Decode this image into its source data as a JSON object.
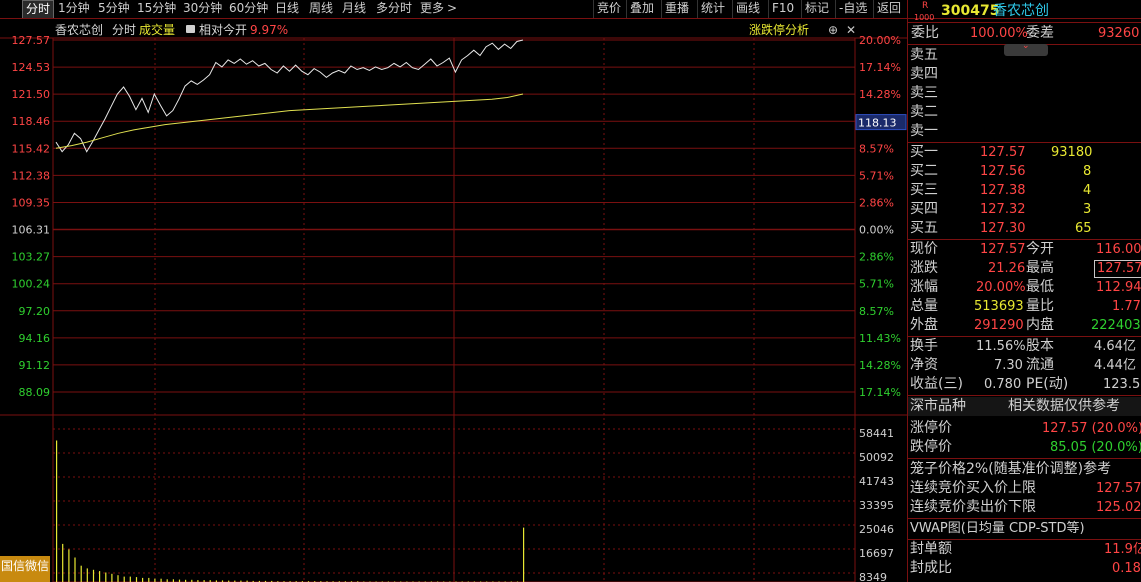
{
  "toolbar": {
    "periods": [
      "分时",
      "1分钟",
      "5分钟",
      "15分钟",
      "30分钟",
      "60分钟",
      "日线",
      "周线",
      "月线",
      "多分时",
      "更多"
    ],
    "more_arrow": ">",
    "actions": [
      "竞价",
      "叠加",
      "重播",
      "统计",
      "画线",
      "F10",
      "标记",
      "-自选",
      "返回"
    ]
  },
  "chart_header": {
    "stock_name": "香农芯创",
    "mode": "分时",
    "volume_label": "成交量",
    "relative_label": "相对今开",
    "relative_value": "9.97%",
    "limit_analysis": "涨跌停分析",
    "plus_icon": "⊕",
    "close_icon": "✕"
  },
  "axis": {
    "price_ticks": [
      "127.57",
      "124.53",
      "121.50",
      "118.46",
      "115.42",
      "112.38",
      "109.35",
      "106.31",
      "103.27",
      "100.24",
      "97.20",
      "94.16",
      "91.12",
      "88.09"
    ],
    "pct_ticks": [
      "20.00%",
      "17.14%",
      "14.28%",
      "11.43%",
      "8.57%",
      "5.71%",
      "2.86%",
      "0.00%",
      "2.86%",
      "5.71%",
      "8.57%",
      "11.43%",
      "14.28%",
      "17.14%"
    ],
    "current_price_tag": "118.13",
    "volume_ticks": [
      "58441",
      "50092",
      "41743",
      "33395",
      "25046",
      "16697",
      "8349"
    ]
  },
  "chart_data": {
    "type": "line",
    "prev_close": 106.31,
    "y_range": [
      85.05,
      127.57
    ],
    "series": [
      {
        "name": "price",
        "color": "#e8e8e8",
        "values": [
          115.9,
          114.8,
          115.6,
          116.9,
          116.3,
          114.8,
          116.0,
          117.3,
          118.6,
          120.0,
          121.4,
          122.2,
          121.1,
          119.6,
          120.9,
          119.3,
          121.4,
          120.1,
          118.9,
          119.5,
          120.8,
          122.3,
          122.9,
          122.5,
          123.0,
          123.6,
          125.0,
          124.5,
          125.3,
          124.9,
          125.4,
          124.8,
          125.2,
          124.6,
          124.9,
          124.2,
          123.8,
          124.6,
          124.0,
          124.7,
          124.0,
          123.6,
          124.3,
          123.9,
          123.3,
          123.8,
          124.1,
          123.8,
          124.6,
          124.2,
          124.4,
          124.1,
          124.5,
          124.2,
          124.4,
          124.9,
          124.5,
          125.0,
          124.4,
          124.2,
          124.8,
          125.4,
          124.6,
          125.0,
          125.5,
          123.9,
          125.3,
          125.8,
          126.4,
          125.8,
          126.8,
          127.2,
          126.5,
          127.1,
          126.6,
          127.4,
          127.57
        ]
      },
      {
        "name": "average",
        "color": "#e0e050",
        "values": [
          115.2,
          115.5,
          115.9,
          116.4,
          116.9,
          117.3,
          117.6,
          117.9,
          118.1,
          118.3,
          118.5,
          118.7,
          118.9,
          119.1,
          119.3,
          119.5,
          119.6,
          119.7,
          119.8,
          119.9,
          120.0,
          120.1,
          120.2,
          120.3,
          120.4,
          120.5,
          120.6,
          120.7,
          120.8,
          121.0,
          121.4
        ]
      }
    ],
    "volume_bars": [
      52000,
      14000,
      12000,
      9000,
      6000,
      5000,
      4500,
      4000,
      3500,
      3000,
      2500,
      2000,
      2000,
      1800,
      1500,
      1500,
      1200,
      1200,
      1000,
      1000,
      900,
      800,
      800,
      700,
      700,
      700,
      600,
      600,
      500,
      500,
      500,
      500,
      400,
      400,
      400,
      400,
      300,
      300,
      300,
      300,
      300,
      300,
      300,
      300,
      250,
      250,
      250,
      250,
      250,
      250,
      200,
      200,
      200,
      200,
      200,
      200,
      200,
      200,
      200,
      200,
      200,
      200,
      200,
      200,
      200,
      200,
      200,
      200,
      200,
      200,
      200,
      200,
      200,
      200,
      200,
      200,
      20000
    ],
    "volume_max": 58441
  },
  "ad": "国信微信",
  "quote": {
    "r_badge": "R",
    "code_sub": "1000",
    "code": "300475",
    "name": "香农芯创",
    "weibi_label": "委比",
    "weibi_value": "100.00%",
    "weicha_label": "委差",
    "weicha_value": "93260",
    "sells": [
      {
        "label": "卖五",
        "price": "",
        "vol": ""
      },
      {
        "label": "卖四",
        "price": "",
        "vol": ""
      },
      {
        "label": "卖三",
        "price": "",
        "vol": ""
      },
      {
        "label": "卖二",
        "price": "",
        "vol": ""
      },
      {
        "label": "卖一",
        "price": "",
        "vol": ""
      }
    ],
    "buys": [
      {
        "label": "买一",
        "price": "127.57",
        "vol": "93180"
      },
      {
        "label": "买二",
        "price": "127.56",
        "vol": "8"
      },
      {
        "label": "买三",
        "price": "127.38",
        "vol": "4"
      },
      {
        "label": "买四",
        "price": "127.32",
        "vol": "3"
      },
      {
        "label": "买五",
        "price": "127.30",
        "vol": "65"
      }
    ],
    "stats": [
      {
        "l1": "现价",
        "v1": "127.57",
        "c1": "r",
        "l2": "今开",
        "v2": "116.00",
        "c2": "r"
      },
      {
        "l1": "涨跌",
        "v1": "21.26",
        "c1": "r",
        "l2": "最高",
        "v2": "127.57",
        "c2": "r"
      },
      {
        "l1": "涨幅",
        "v1": "20.00%",
        "c1": "r",
        "l2": "最低",
        "v2": "112.94",
        "c2": "r"
      },
      {
        "l1": "总量",
        "v1": "513693",
        "c1": "y",
        "l2": "量比",
        "v2": "1.77",
        "c2": "r"
      },
      {
        "l1": "外盘",
        "v1": "291290",
        "c1": "r",
        "l2": "内盘",
        "v2": "222403",
        "c2": "g"
      }
    ],
    "stats2": [
      {
        "l1": "换手",
        "v1": "11.56%",
        "l2": "股本",
        "v2": "4.64亿"
      },
      {
        "l1": "净资",
        "v1": "7.30",
        "l2": "流通",
        "v2": "4.44亿"
      },
      {
        "l1": "收益(三)",
        "v1": "0.780",
        "l2": "PE(动)",
        "v2": "123.5"
      }
    ],
    "market_label": "深市品种",
    "market_note": "相关数据仅供参考",
    "limit_up_label": "涨停价",
    "limit_up_value": "127.57 (20.0%)",
    "limit_down_label": "跌停价",
    "limit_down_value": "85.05 (20.0%)",
    "cage_label": "笼子价格2%(随基准价调整)参考",
    "cont_buy_label": "连续竞价买入价上限",
    "cont_buy_value": "127.57",
    "cont_sell_label": "连续竞价卖出价下限",
    "cont_sell_value": "125.02",
    "vwap_label": "VWAP图(日均量 CDP-STD等)",
    "seal_amount_label": "封单额",
    "seal_amount_value": "11.9亿",
    "seal_ratio_label": "封成比",
    "seal_ratio_value": "0.18"
  },
  "colors": {
    "background": "#000000",
    "grid_red": "#7a1010",
    "up_red": "#ff4545",
    "down_green": "#2fd02f",
    "neutral": "#d0d0d0",
    "yellow": "#e8e832",
    "cyan": "#2ec8e8",
    "ad_gold": "#c88a10"
  }
}
